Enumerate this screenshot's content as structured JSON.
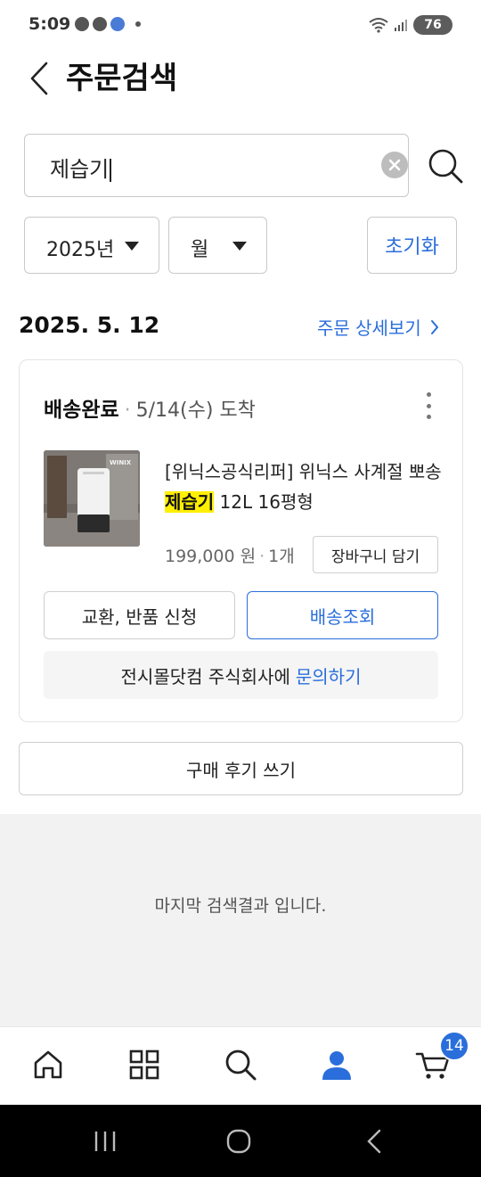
{
  "status_bar": {
    "time": "5:09",
    "battery": "76"
  },
  "header": {
    "title": "주문검색"
  },
  "search": {
    "value": "제습기"
  },
  "filters": {
    "year": "2025년",
    "month": "월",
    "reset_label": "초기화"
  },
  "order": {
    "date": "2025. 5. 12",
    "detail_link": "주문 상세보기",
    "status": "배송완료",
    "arrival": "5/14(수) 도착",
    "product": {
      "name_before": "[위닉스공식리퍼] 위닉스 사계절 뽀송 ",
      "name_highlight": "제습기",
      "name_after": " 12L 16평형",
      "price": "199,000 원",
      "quantity": "1개",
      "thumb_brand": "WINIX"
    },
    "cart_button": "장바구니 담기",
    "exchange_button": "교환, 반품 신청",
    "tracking_button": "배송조회",
    "inquiry_text": "전시몰닷컴 주식회사에",
    "inquiry_link": "문의하기"
  },
  "review_button": "구매 후기 쓰기",
  "end_message": "마지막 검색결과 입니다.",
  "bottom_nav": {
    "cart_count": "14",
    "active": "my-page"
  },
  "colors": {
    "accent": "#2a6edb",
    "highlight": "#ffef00"
  }
}
